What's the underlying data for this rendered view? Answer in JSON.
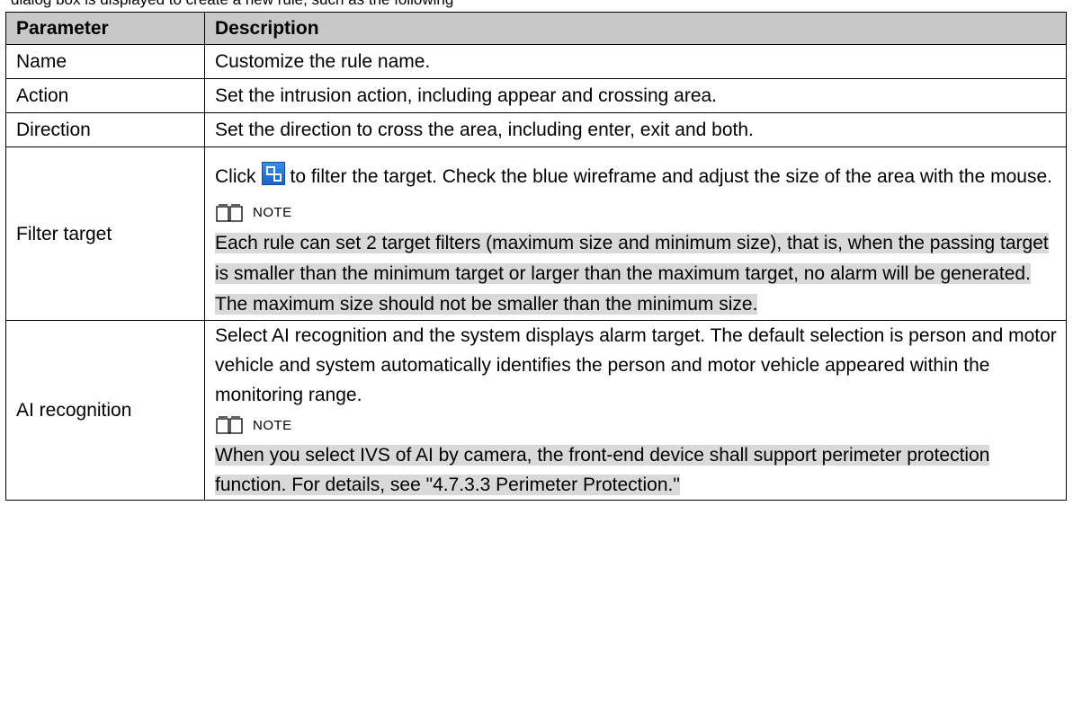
{
  "intro": "dialog box is displayed to create a new rule, such as the following",
  "table": {
    "headers": [
      "Parameter",
      "Description"
    ],
    "rows": [
      {
        "param": "Name",
        "desc": "Customize the rule name."
      },
      {
        "param": "Action",
        "desc": "Set the intrusion action, including appear and crossing area."
      },
      {
        "param": "Direction",
        "desc": "Set the direction to cross the area, including enter, exit and both."
      },
      {
        "param": "Filter target",
        "desc_pre": "Click",
        "desc_post": "to filter the target. Check the blue wireframe and adjust the size of the area with the mouse.",
        "icon": "filter-target-icon",
        "note_label": "NOTE",
        "note_text": "Each rule can set 2 target filters (maximum size and minimum size), that is, when the passing target is smaller than the minimum target or larger than the maximum target, no alarm will be generated. The maximum size should not be smaller than the minimum size."
      },
      {
        "param": "AI recognition",
        "desc": "Select AI recognition and the system displays alarm target. The default selection is person and motor vehicle and system automatically identifies the person and motor vehicle appeared within the monitoring range.",
        "note_label": "NOTE",
        "note_text": "When you select IVS of AI by camera, the front-end device shall support perimeter protection function. For details, see \"4.7.3.3 Perimeter Protection.\""
      }
    ]
  },
  "colors": {
    "header_bg": "#c8c8c8",
    "note_highlight": "#d9d9d9",
    "icon_blue": "#1a6fd2"
  }
}
